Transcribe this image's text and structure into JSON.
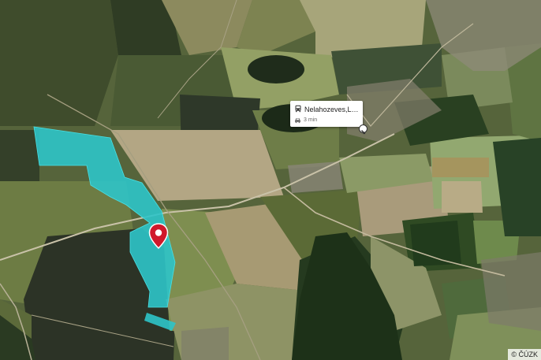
{
  "map": {
    "type": "aerial",
    "highlight_color": "#2ec4c9",
    "pin_color": "#d0182b"
  },
  "popup": {
    "title": "Nelahozeves,Leš...",
    "travel_time": "3 min",
    "icon": "bus-icon",
    "time_icon": "car-icon"
  },
  "attribution": {
    "text": "© ČÚZK"
  }
}
